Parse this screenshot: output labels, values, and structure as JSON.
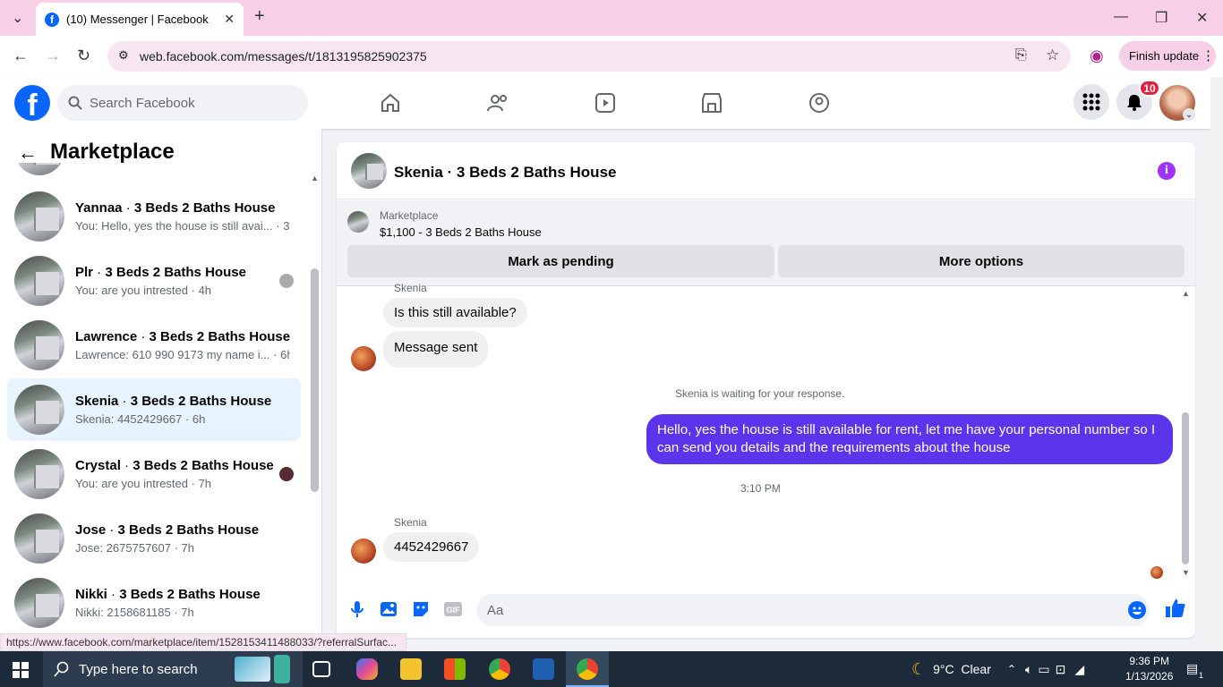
{
  "browser": {
    "tab_title": "(10) Messenger | Facebook",
    "url": "web.facebook.com/messages/t/1813195825902375",
    "finish_update": "Finish update",
    "status_url": "https://www.facebook.com/marketplace/item/1528153411488033/?referralSurfac..."
  },
  "fb": {
    "logo": "f",
    "search_placeholder": "Search Facebook",
    "notification_count": "10",
    "nav_icons": [
      "home-icon",
      "friends-icon",
      "video-icon",
      "marketplace-icon",
      "gaming-icon"
    ]
  },
  "sidebar": {
    "title": "Marketplace",
    "conversations": [
      {
        "name": "Yannaa",
        "listing": "3 Beds 2 Baths House",
        "preview": "You: Hello, yes the house is still avai...",
        "time": "3h"
      },
      {
        "name": "Plr",
        "listing": "3 Beds 2 Baths House",
        "preview": "You: are you intrested",
        "time": "4h"
      },
      {
        "name": "Lawrence",
        "listing": "3 Beds 2 Baths House",
        "preview": "Lawrence: 610 990 9173 my name i...",
        "time": "6h"
      },
      {
        "name": "Skenia",
        "listing": "3 Beds 2 Baths House",
        "preview": "Skenia: 4452429667",
        "time": "6h"
      },
      {
        "name": "Crystal",
        "listing": "3 Beds 2 Baths House",
        "preview": "You: are you intrested",
        "time": "7h"
      },
      {
        "name": "Jose",
        "listing": "3 Beds 2 Baths House",
        "preview": "Jose: 2675757607",
        "time": "7h"
      },
      {
        "name": "Nikki",
        "listing": "3 Beds 2 Baths House",
        "preview": "Nikki: 2158681185",
        "time": "7h"
      }
    ]
  },
  "chat": {
    "title": "Skenia · 3 Beds 2 Baths House",
    "marketplace_label": "Marketplace",
    "listing": "$1,100 - 3 Beds 2 Baths House",
    "mark_pending": "Mark as pending",
    "more_options": "More options",
    "sender_1": "Skenia",
    "msg_1": "Is this still available?",
    "msg_2": "Message sent",
    "waiting": "Skenia is waiting for your response.",
    "outgoing": "Hello, yes the house is still available for rent, let me have your personal number so I can send you details and the requirements about the house",
    "timestamp": "3:10 PM",
    "sender_2": "Skenia",
    "msg_3": "4452429667",
    "composer_placeholder": "Aa"
  },
  "taskbar": {
    "search_placeholder": "Type here to search",
    "weather": "9°C  Clear",
    "time": "9:36 PM",
    "date": "1/13/2026",
    "notif": "1"
  },
  "colors": {
    "accent": "#0866ff",
    "outgoing_bubble": "#5b35ec",
    "info": "#a033ff",
    "badge": "#e41e3f"
  }
}
